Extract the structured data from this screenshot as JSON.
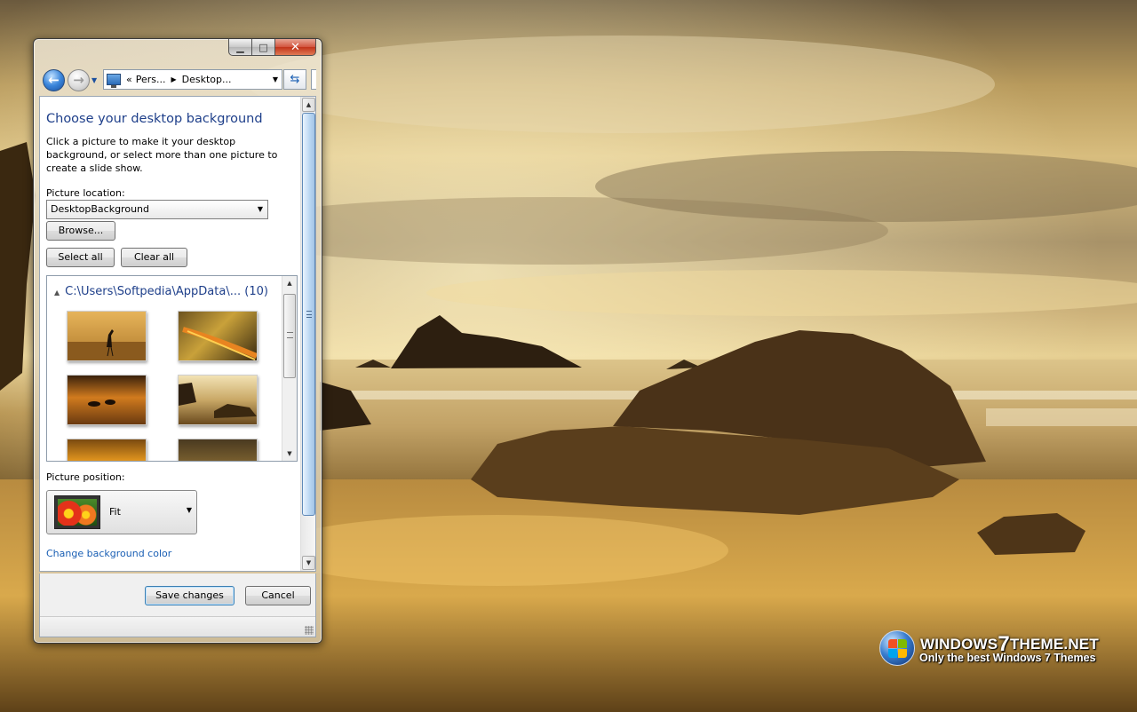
{
  "window": {
    "caption": {
      "minimize": "▁",
      "maximize": "□",
      "close": "✕"
    },
    "breadcrumb": {
      "separator": "«",
      "items": [
        "Pers...",
        "Desktop..."
      ]
    },
    "icons": {
      "back": "back-arrow-icon",
      "forward": "forward-arrow-icon",
      "recent": "dropdown-icon",
      "address": "control-panel-icon",
      "refresh": "refresh-icon"
    },
    "content": {
      "title": "Choose your desktop background",
      "description": "Click a picture to make it your desktop background, or select more than one picture to create a slide show.",
      "picture_location_label": "Picture location:",
      "picture_location_value": "DesktopBackground",
      "browse_label": "Browse...",
      "select_all_label": "Select all",
      "clear_all_label": "Clear all",
      "group": {
        "path": "C:\\Users\\Softpedia\\AppData\\...",
        "count": "(10)"
      },
      "picture_position_label": "Picture position:",
      "picture_position_value": "Fit",
      "change_color_link": "Change background color"
    },
    "footer": {
      "save_label": "Save changes",
      "cancel_label": "Cancel"
    }
  },
  "branding": {
    "title_part1": "WINDOWS",
    "title_seven": "7",
    "title_part2": "THEME.NET",
    "subtitle": "Only the best Windows 7 Themes"
  },
  "colors": {
    "heading": "#1e3f8a",
    "link": "#1a5fb4",
    "close_button": "#c2341a"
  }
}
